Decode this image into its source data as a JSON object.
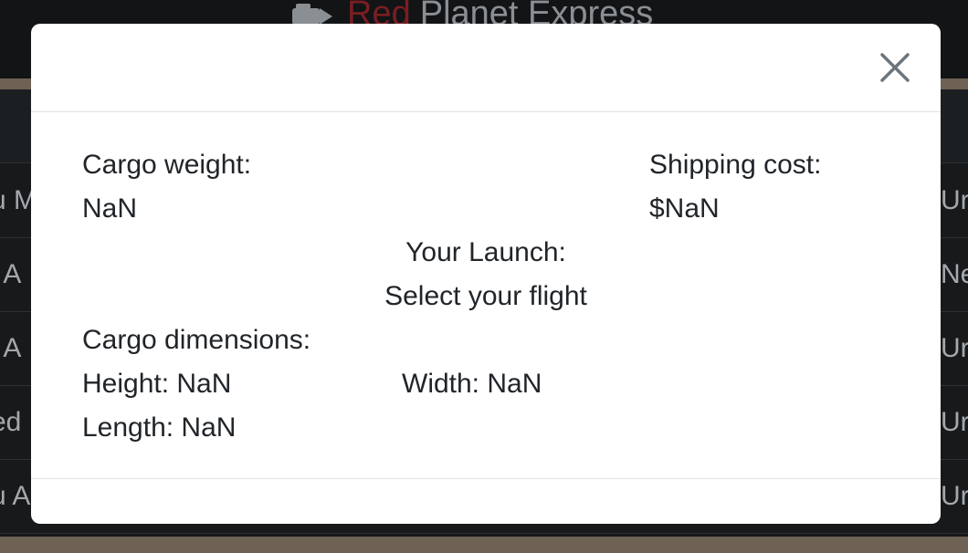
{
  "app": {
    "brand_part1": "Red",
    "brand_part2": "Planet Express"
  },
  "background_rows": [
    {
      "left": "u M",
      "right": "Ur"
    },
    {
      "left": "i A",
      "right": "Ne"
    },
    {
      "left": "i A",
      "right": "Ur"
    },
    {
      "left": "ed",
      "right": "Ur"
    },
    {
      "left": "u A",
      "right": "Ur"
    }
  ],
  "modal": {
    "close_symbol": "×",
    "cargo_weight_label": "Cargo weight:",
    "cargo_weight_value": "NaN",
    "shipping_cost_label": "Shipping cost:",
    "shipping_cost_value": "$NaN",
    "launch_label": "Your Launch:",
    "launch_value": "Select your flight",
    "dimensions_label": "Cargo dimensions:",
    "height_text": "Height: NaN",
    "width_text": "Width: NaN",
    "length_text": "Length: NaN"
  },
  "colors": {
    "accent_red": "#dc3545",
    "header_dark": "#121416",
    "modal_bg": "#ffffff",
    "text": "#212529",
    "divider": "#dee2e6"
  },
  "icons": {
    "close": "close-icon",
    "logo": "rocket-logo-icon"
  }
}
